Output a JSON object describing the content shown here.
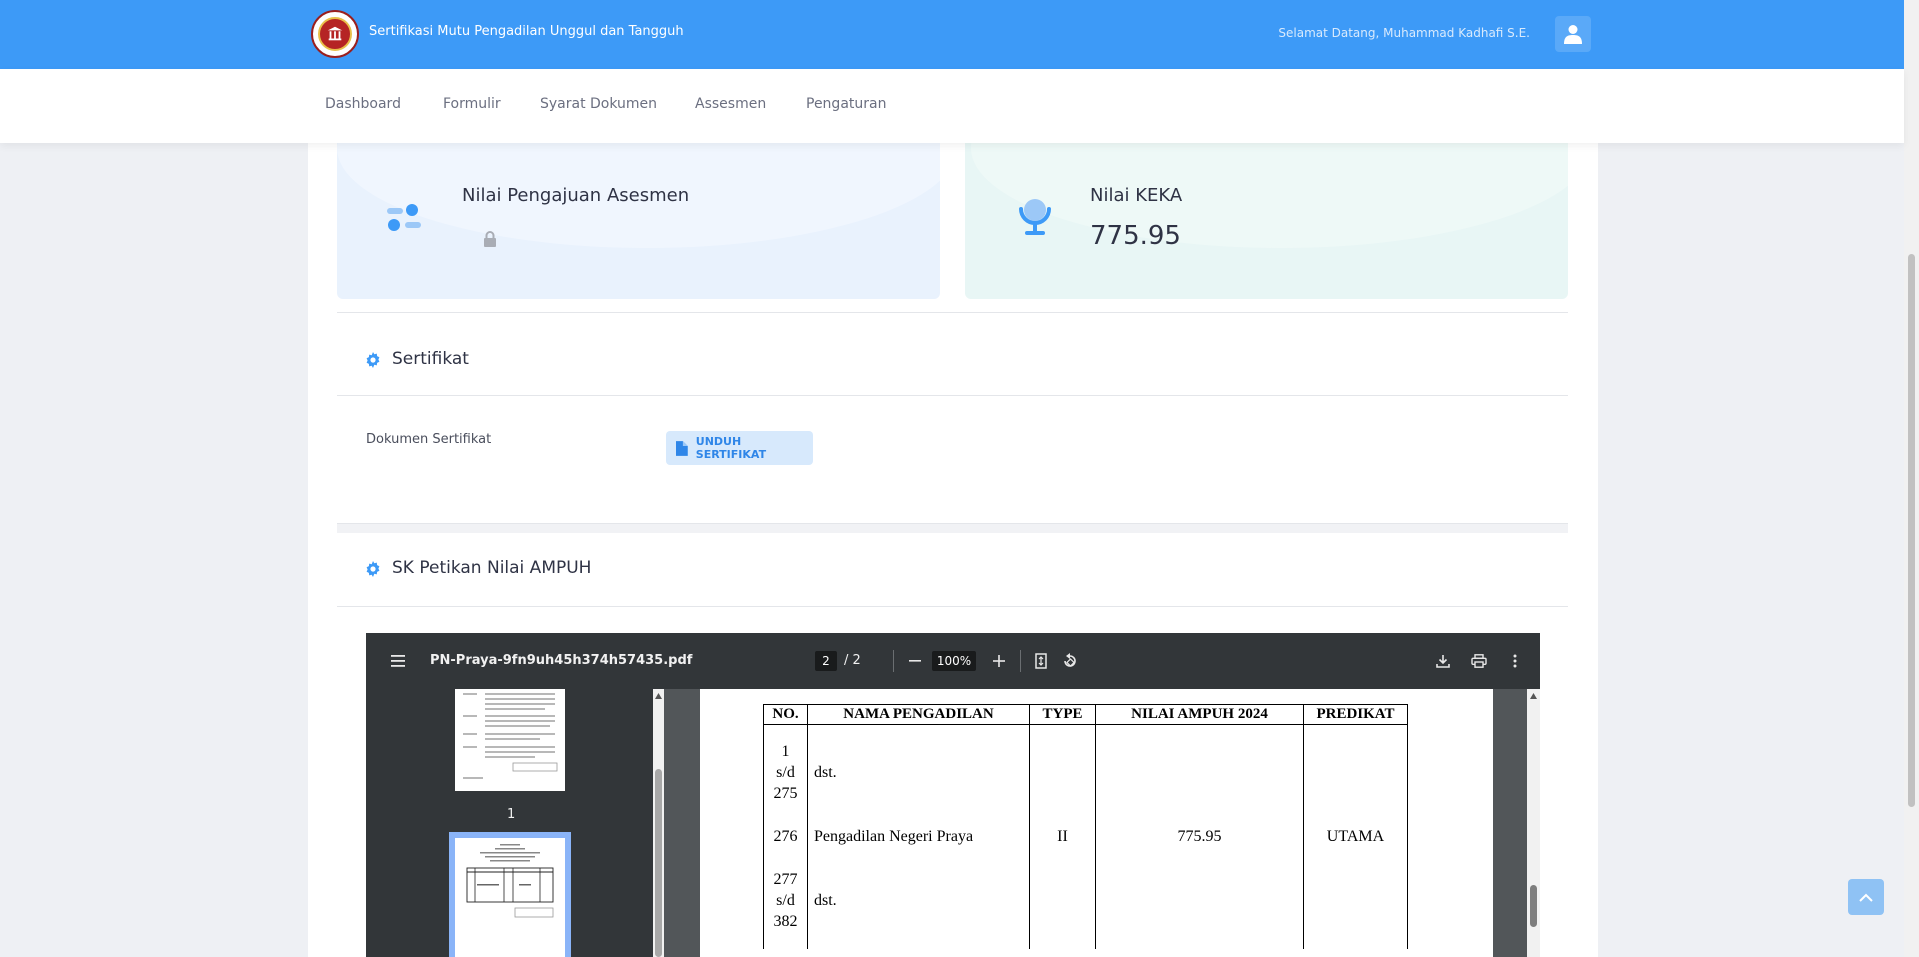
{
  "header": {
    "app_title": "Sertifikasi Mutu Pengadilan Unggul dan Tangguh",
    "welcome": "Selamat Datang, Muhammad Kadhafi S.E."
  },
  "nav": {
    "items": [
      "Dashboard",
      "Formulir",
      "Syarat Dokumen",
      "Assesmen",
      "Pengaturan"
    ]
  },
  "stats": {
    "pengajuan_label": "Nilai Pengajuan Asesmen",
    "keka_label": "Nilai KEKA",
    "keka_value": "775.95"
  },
  "sertifikat": {
    "title": "Sertifikat",
    "doc_label": "Dokumen Sertifikat",
    "download_label": "UNDUH SERTIFIKAT"
  },
  "sk": {
    "title": "SK Petikan Nilai AMPUH"
  },
  "pdf": {
    "filename": "PN-Praya-9fn9uh45h374h57435.pdf",
    "current_page": "2",
    "total_pages": "/  2",
    "zoom": "100%",
    "thumb_label": "1",
    "table": {
      "headers": [
        "NO.",
        "NAMA PENGADILAN",
        "TYPE",
        "NILAI AMPUH 2024",
        "PREDIKAT"
      ],
      "rows": [
        {
          "no": "1\ns/d\n275",
          "nama": "dst.",
          "type": "",
          "nilai": "",
          "predikat": ""
        },
        {
          "no": "276",
          "nama": "Pengadilan Negeri Praya",
          "type": "II",
          "nilai": "775.95",
          "predikat": "UTAMA"
        },
        {
          "no": "277\ns/d\n382",
          "nama": "dst.",
          "type": "",
          "nilai": "",
          "predikat": ""
        }
      ]
    }
  },
  "colors": {
    "primary": "#3d9af7",
    "pdf_toolbar": "#323639"
  }
}
